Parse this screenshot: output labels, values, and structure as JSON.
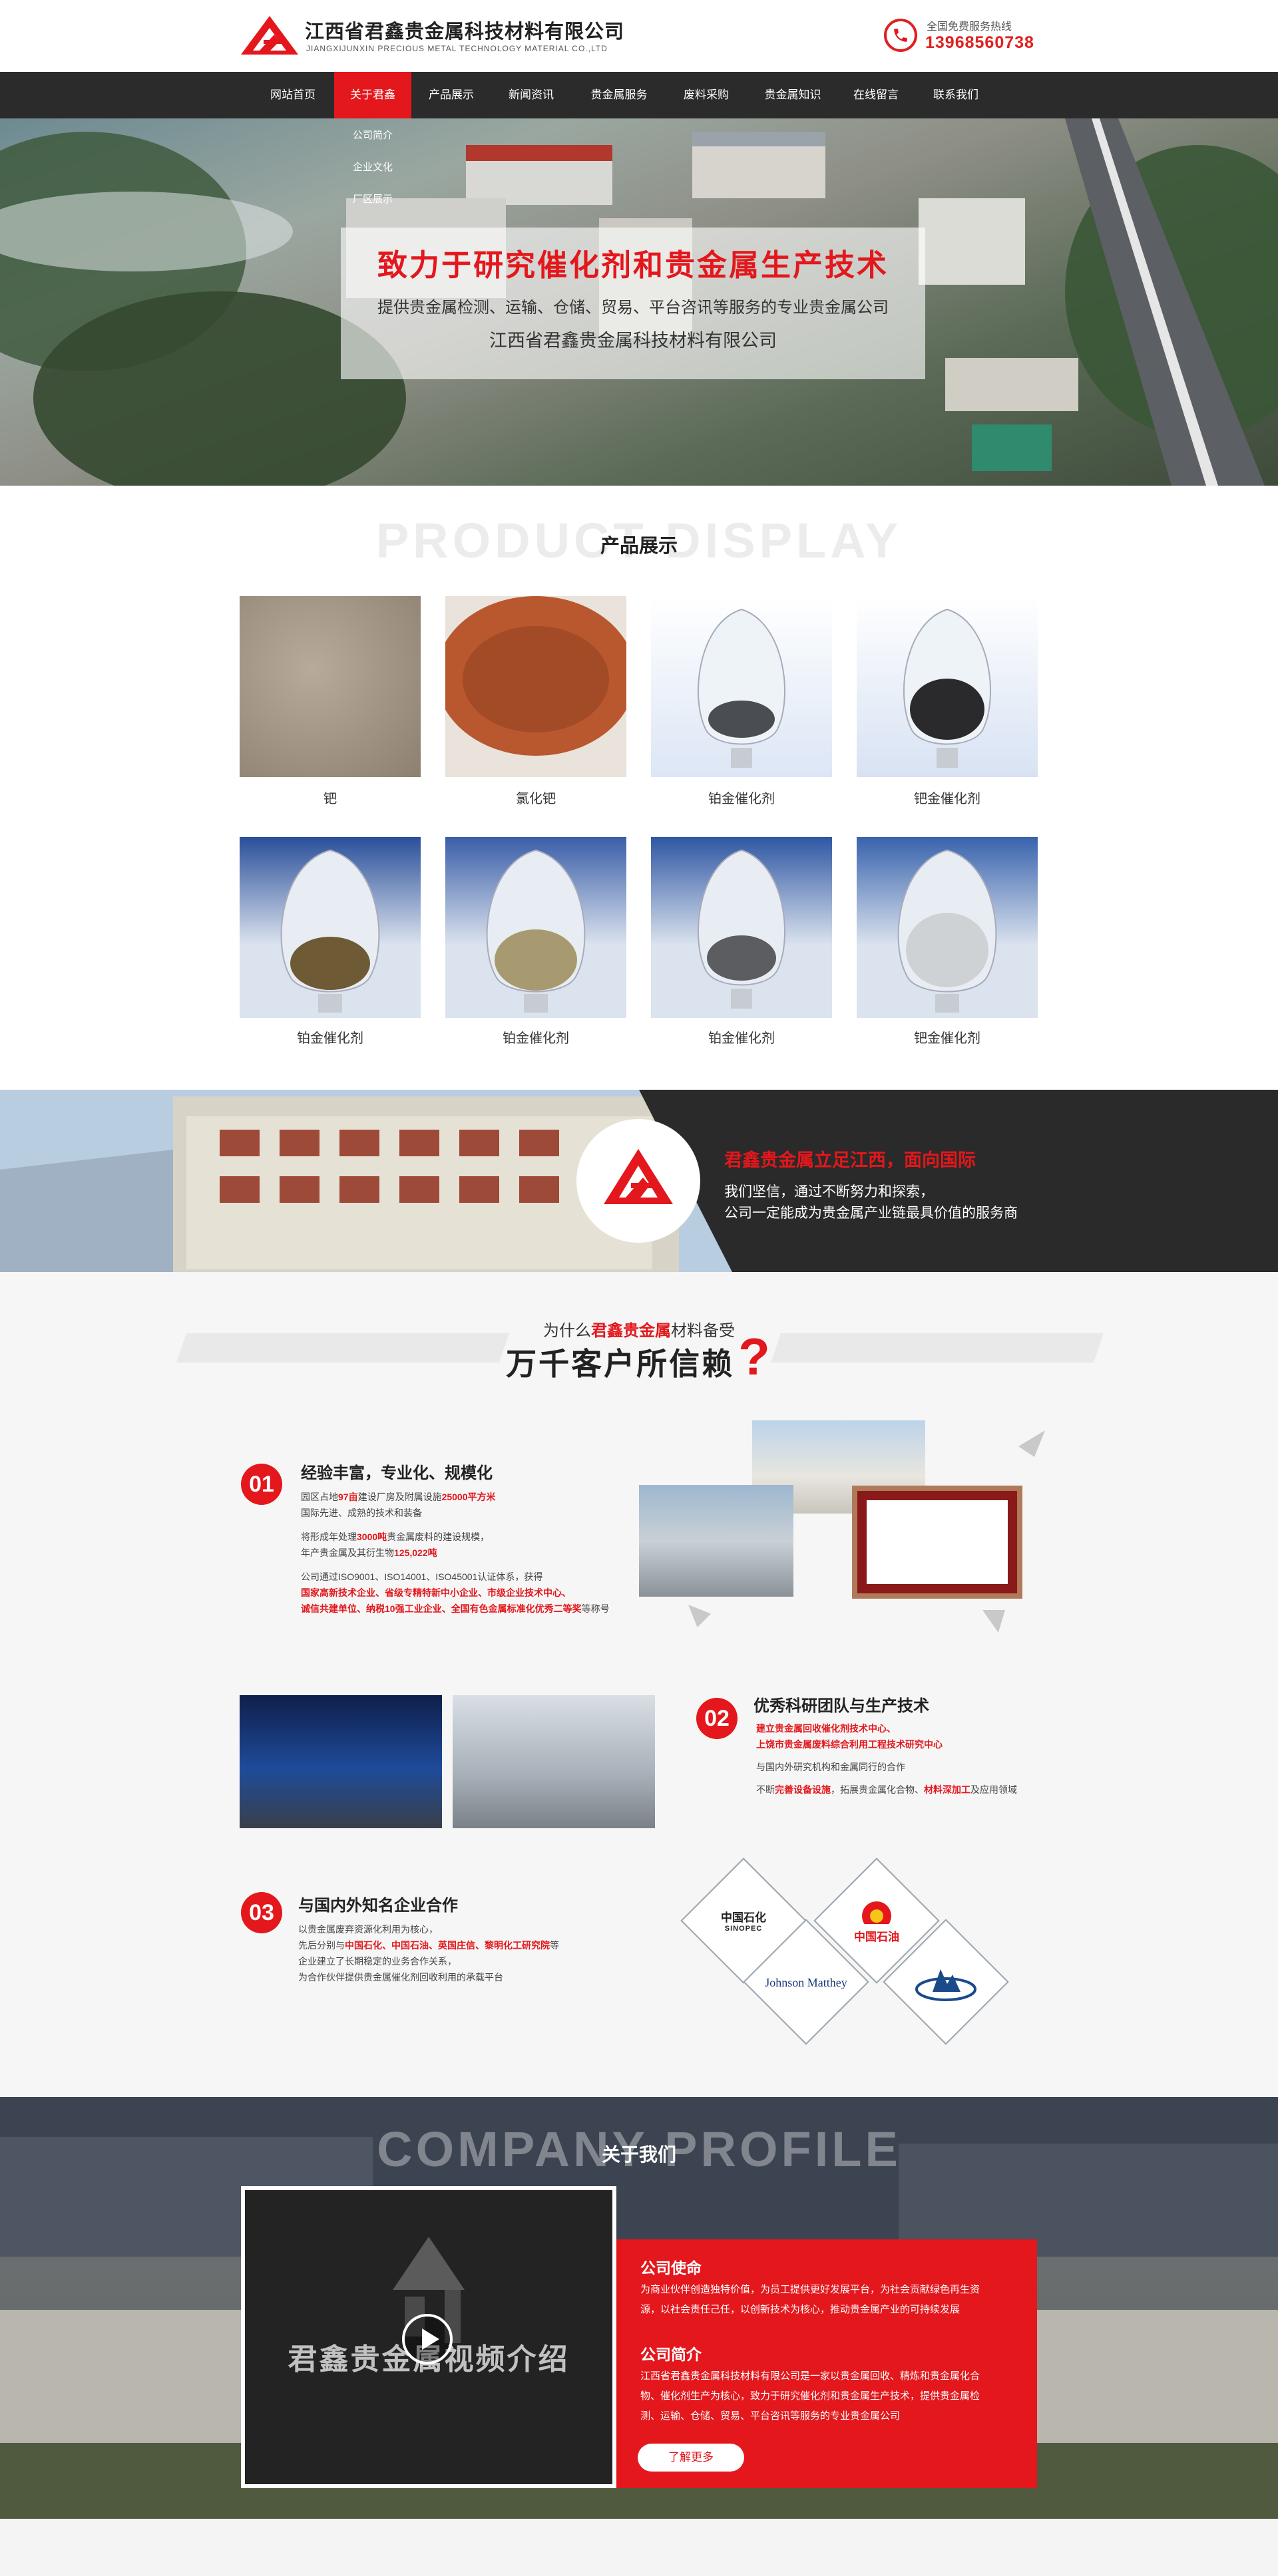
{
  "header": {
    "company_name": "江西省君鑫贵金属科技材料有限公司",
    "company_en": "JIANGXIJUNXIN PRECIOUS METAL TECHNOLOGY MATERIAL CO.,LTD",
    "hotline_label": "全国免费服务热线",
    "hotline_number": "13968560738"
  },
  "nav": {
    "items": [
      {
        "label": "网站首页"
      },
      {
        "label": "关于君鑫"
      },
      {
        "label": "产品展示"
      },
      {
        "label": "新闻资讯"
      },
      {
        "label": "贵金属服务"
      },
      {
        "label": "废料采购"
      },
      {
        "label": "贵金属知识"
      },
      {
        "label": "在线留言"
      },
      {
        "label": "联系我们"
      }
    ],
    "active_index": 1,
    "submenu": [
      {
        "label": "公司简介"
      },
      {
        "label": "企业文化"
      },
      {
        "label": "厂区展示"
      }
    ]
  },
  "banner": {
    "headline": "致力于研究催化剂和贵金属生产技术",
    "subline": "提供贵金属检测、运输、仓储、贸易、平台咨讯等服务的专业贵金属公司",
    "company": "江西省君鑫贵金属科技材料有限公司"
  },
  "products": {
    "ghost": "PRODUCT DISPLAY",
    "title": "产品展示",
    "items": [
      {
        "name": "钯",
        "icon": "powder-gray"
      },
      {
        "name": "氯化钯",
        "icon": "powder-brown"
      },
      {
        "name": "铂金催化剂",
        "icon": "flask-dark-granules"
      },
      {
        "name": "钯金催化剂",
        "icon": "flask-black-granules"
      },
      {
        "name": "铂金催化剂",
        "icon": "flask-brown-flakes"
      },
      {
        "name": "铂金催化剂",
        "icon": "flask-light-flakes"
      },
      {
        "name": "铂金催化剂",
        "icon": "flask-gray-pellets"
      },
      {
        "name": "钯金催化剂",
        "icon": "flask-white-pellets"
      }
    ]
  },
  "strip": {
    "headline": "君鑫贵金属立足江西，面向国际",
    "line1": "我们坚信，通过不断努力和探索，",
    "line2": "公司一定能成为贵金属产业链最具价值的服务商"
  },
  "why": {
    "line1_prefix": "为什么",
    "line1_brand": "君鑫贵金属",
    "line1_suffix": "材料备受",
    "line2": "万千客户所信赖",
    "question_mark": "?",
    "points": [
      {
        "num": "01",
        "title": "经验丰富，专业化、规模化",
        "l1a": "园区占地",
        "l1b": "97亩",
        "l1c": "建设厂房及附属设施",
        "l1d": "25000平方米",
        "l2": "国际先进、成熟的技术和装备",
        "l3a": "将形成年处理",
        "l3b": "3000吨",
        "l3c": "贵金属废料的建设规模，",
        "l4a": "年产贵金属及其衍生物",
        "l4b": "125,022吨",
        "l5": "公司通过ISO9001、ISO14001、ISO45001认证体系，获得",
        "l6": "国家高新技术企业、省级专精特新中小企业、市级企业技术中心、",
        "l7a": "诚信共建单位、纳税10强工业企业、全国有色金属标准化优秀二等奖",
        "l7b": "等称号"
      },
      {
        "num": "02",
        "title": "优秀科研团队与生产技术",
        "l1": "建立贵金属回收催化剂技术中心、",
        "l2": "上饶市贵金属废料综合利用工程技术研究中心",
        "l3": "与国内外研究机构和金属同行的合作",
        "l4a": "不断",
        "l4b": "完善设备设施",
        "l4c": "，拓展贵金属化合物、",
        "l4d": "材料深加工",
        "l4e": "及应用领域"
      },
      {
        "num": "03",
        "title": "与国内外知名企业合作",
        "l1": "以贵金属废弃资源化利用为核心，",
        "l2a": "先后分别与",
        "l2b": "中国石化、中国石油、英国庄信、黎明化工研究院",
        "l2c": "等",
        "l3": "企业建立了长期稳定的业务合作关系，",
        "l4": "为合作伙伴提供贵金属催化剂回收利用的承载平台"
      }
    ],
    "partners": [
      {
        "name": "中国石化",
        "sub": "SINOPEC"
      },
      {
        "name": "中国石油",
        "sub": ""
      },
      {
        "name": "Johnson Matthey",
        "sub": ""
      },
      {
        "name": "",
        "sub": ""
      }
    ]
  },
  "about": {
    "ghost": "COMPANY PROFILE",
    "title": "关于我们",
    "video_caption": "君鑫贵金属视频介绍",
    "mission_title": "公司使命",
    "mission_1": "为商业伙伴创造独特价值，为员工提供更好发展平台，为社会贡献绿色再生资",
    "mission_2": "源，以社会责任己任，以创新技术为核心，推动贵金属产业的可持续发展",
    "intro_title": "公司简介",
    "intro_1": "江西省君鑫贵金属科技材料有限公司是一家以贵金属回收、精炼和贵金属化合",
    "intro_2": "物、催化剂生产为核心，致力于研究催化剂和贵金属生产技术，提供贵金属检",
    "intro_3": "测、运输、仓储、贸易、平台咨讯等服务的专业贵金属公司",
    "more": "了解更多"
  },
  "colors": {
    "brand": "#e3171c",
    "nav_bg": "#2b2b2b",
    "dark": "#2a2a2a"
  }
}
